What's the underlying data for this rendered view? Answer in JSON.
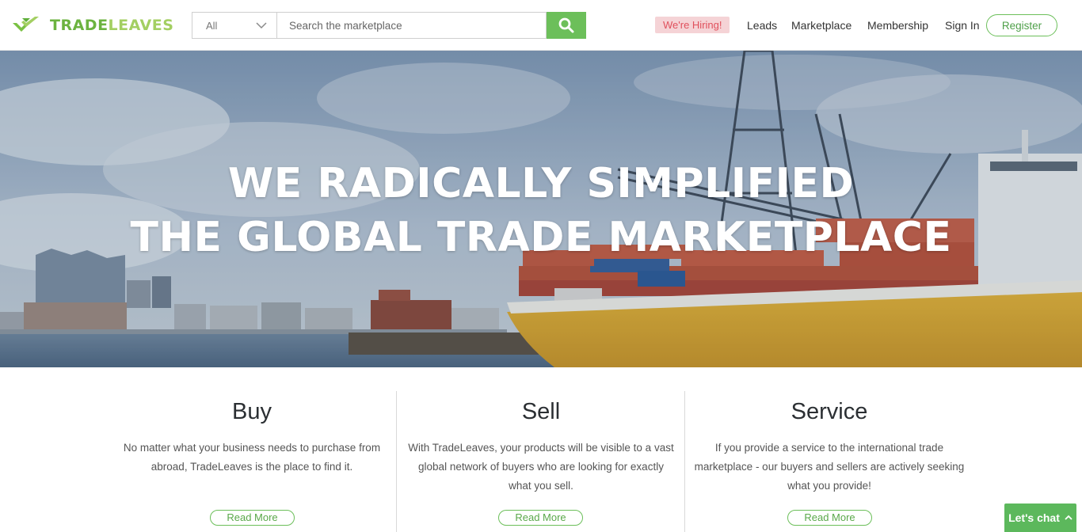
{
  "brand": {
    "part1": "TRADE",
    "part2": "LEAVES",
    "accent": "#6cbf5a"
  },
  "search": {
    "category": "All",
    "placeholder": "Search the marketplace",
    "icon": "search-icon"
  },
  "nav": {
    "hiring": "We're Hiring!",
    "leads": "Leads",
    "marketplace": "Marketplace",
    "membership": "Membership",
    "sign_in": "Sign In",
    "register": "Register"
  },
  "hero": {
    "line1": "WE RADICALLY SIMPLIFIED",
    "line2": "THE GLOBAL TRADE MARKETPLACE"
  },
  "features": [
    {
      "title": "Buy",
      "text": "No matter what your business needs to purchase from abroad, TradeLeaves is the place to find it.",
      "button": "Read More"
    },
    {
      "title": "Sell",
      "text": "With TradeLeaves, your products will be visible to a vast global network of buyers who are looking for exactly what you sell.",
      "button": "Read More"
    },
    {
      "title": "Service",
      "text": "If you provide a service to the international trade marketplace - our buyers and sellers are actively seeking what you provide!",
      "button": "Read More"
    }
  ],
  "chat": {
    "label": "Let's chat",
    "icon": "chevron-up-icon"
  }
}
